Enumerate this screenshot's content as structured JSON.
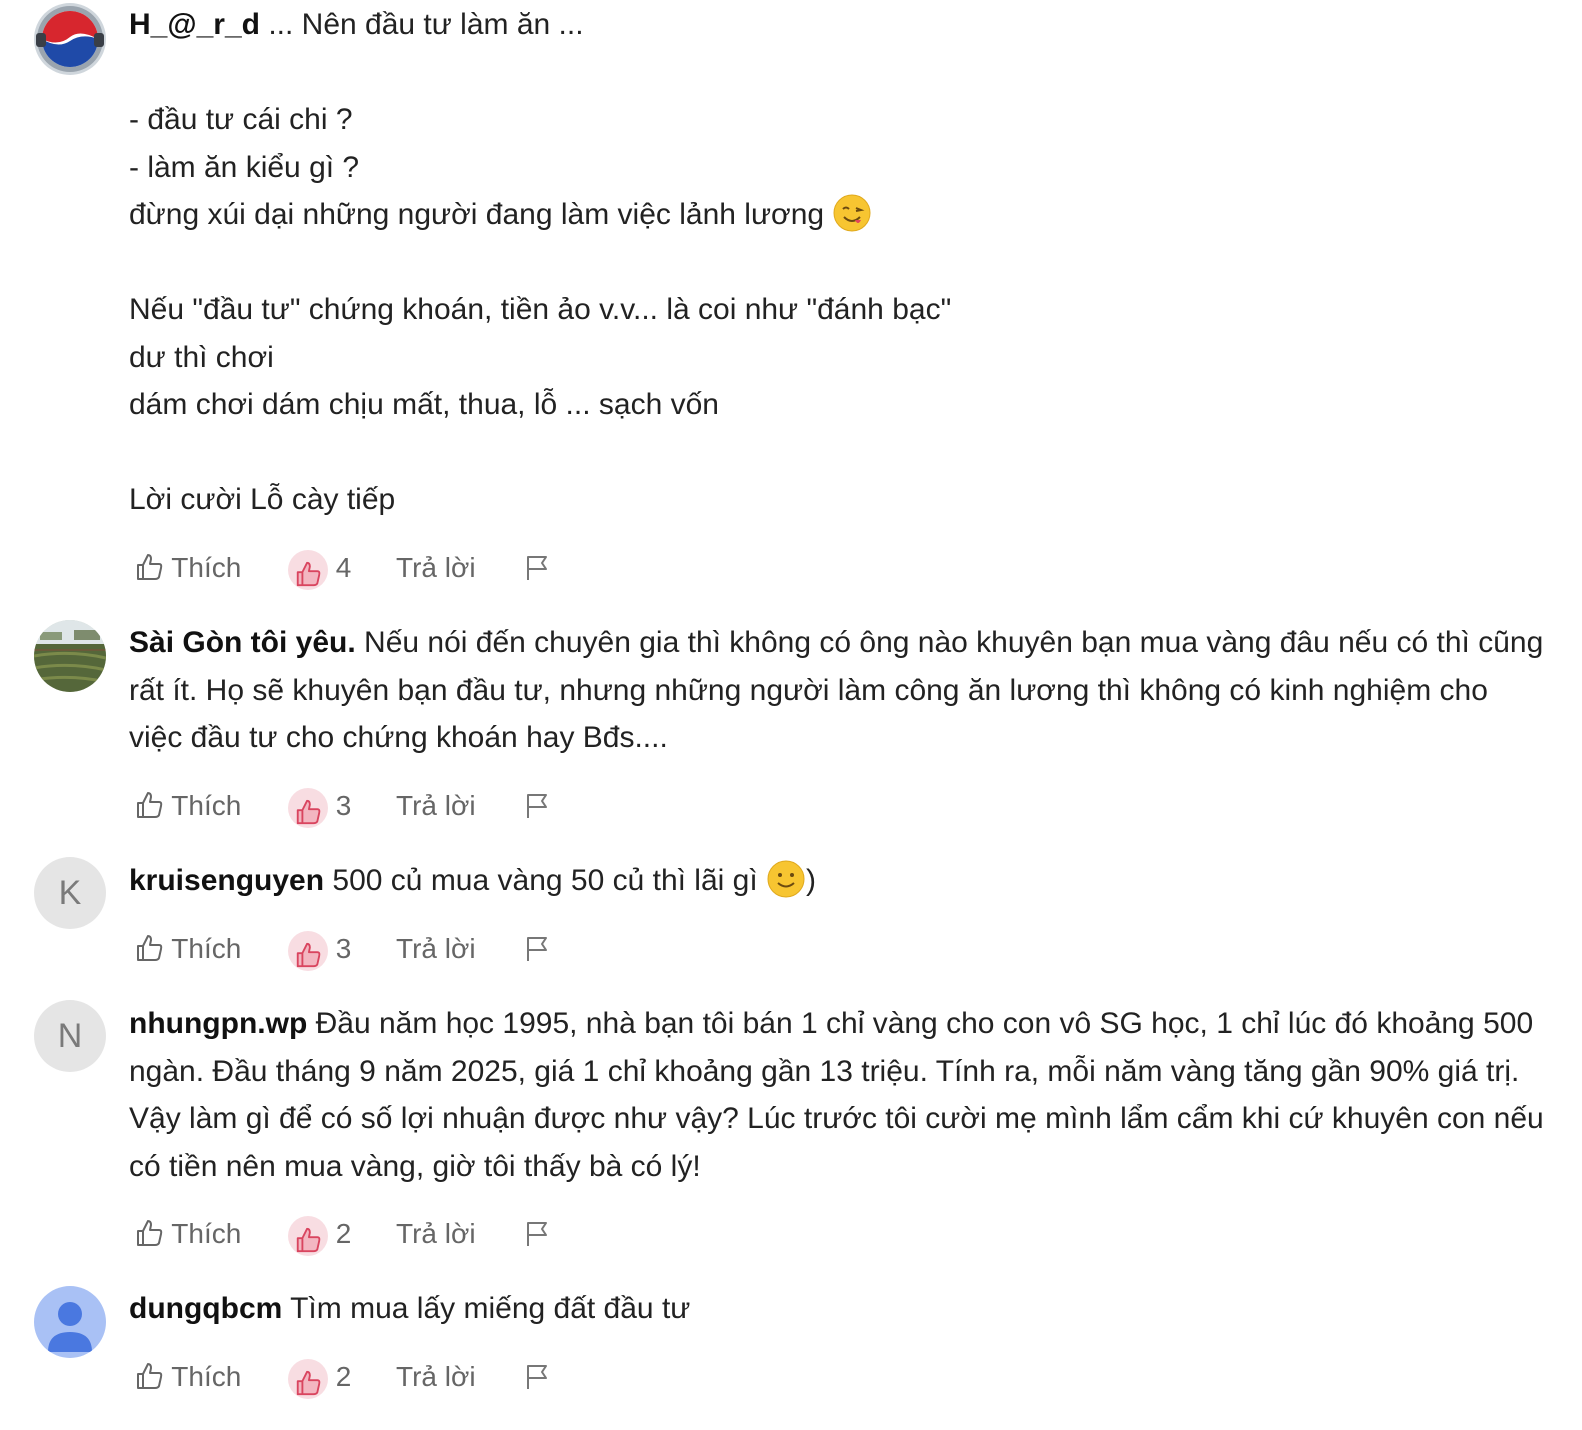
{
  "comments": [
    {
      "author": "H_@_r_d",
      "text_lines": [
        "... Nên đầu tư làm ăn ...",
        "",
        "- đầu tư cái chi ?",
        "- làm ăn kiểu gì ?",
        "đừng xúi dại những người đang làm việc lảnh lương",
        "",
        "Nếu \"đầu tư\" chứng khoán, tiền ảo v.v... là coi như \"đánh bạc\"",
        "dư thì chơi",
        "dám chơi dám chịu mất, thua, lỗ ... sạch vốn",
        "",
        "Lời cười Lỗ cày tiếp"
      ],
      "emoji": "yum-face-emoji",
      "like_label": "Thích",
      "reaction_count": "4",
      "reply_label": "Trả lời",
      "avatar": "pepsi-logo-avatar"
    },
    {
      "author": "Sài Gòn tôi yêu.",
      "text": "Nếu nói đến chuyên gia thì không có ông nào khuyên bạn mua vàng đâu nếu có thì cũng rất ít. Họ sẽ khuyên bạn đầu tư, nhưng những người làm công ăn lương thì không có kinh nghiệm cho việc đầu tư cho chứng khoán hay Bđs....",
      "like_label": "Thích",
      "reaction_count": "3",
      "reply_label": "Trả lời",
      "avatar": "field-photo-avatar"
    },
    {
      "author": "kruisenguyen",
      "text": "500 củ mua vàng 50 củ thì lãi gì",
      "text_after_emoji": ")",
      "emoji": "smile-face-emoji",
      "like_label": "Thích",
      "reaction_count": "3",
      "reply_label": "Trả lời",
      "avatar_letter": "K"
    },
    {
      "author": "nhungpn.wp",
      "text": "Đầu năm học 1995, nhà bạn tôi bán 1 chỉ vàng cho con vô SG học, 1 chỉ lúc đó khoảng 500 ngàn. Đầu tháng 9 năm 2025, giá 1 chỉ khoảng gần 13 triệu. Tính ra, mỗi năm vàng tăng gần 90% giá trị. Vậy làm gì để có số lợi nhuận được như vậy? Lúc trước tôi cười mẹ mình lẩm cẩm khi cứ khuyên con nếu có tiền nên mua vàng, giờ tôi thấy bà có lý!",
      "like_label": "Thích",
      "reaction_count": "2",
      "reply_label": "Trả lời",
      "avatar_letter": "N"
    },
    {
      "author": "dungqbcm",
      "text": "Tìm mua lấy miếng đất đầu tư",
      "like_label": "Thích",
      "reaction_count": "2",
      "reply_label": "Trả lời",
      "avatar": "default-user-avatar"
    }
  ],
  "colors": {
    "text": "#222222",
    "muted": "#666666",
    "reaction_bg": "#f8dde2",
    "reaction_icon": "#d9455f",
    "letter_avatar_bg": "#e5e5e5",
    "default_avatar_bg": "#a9c1f5",
    "default_avatar_fg": "#4a78e0"
  }
}
